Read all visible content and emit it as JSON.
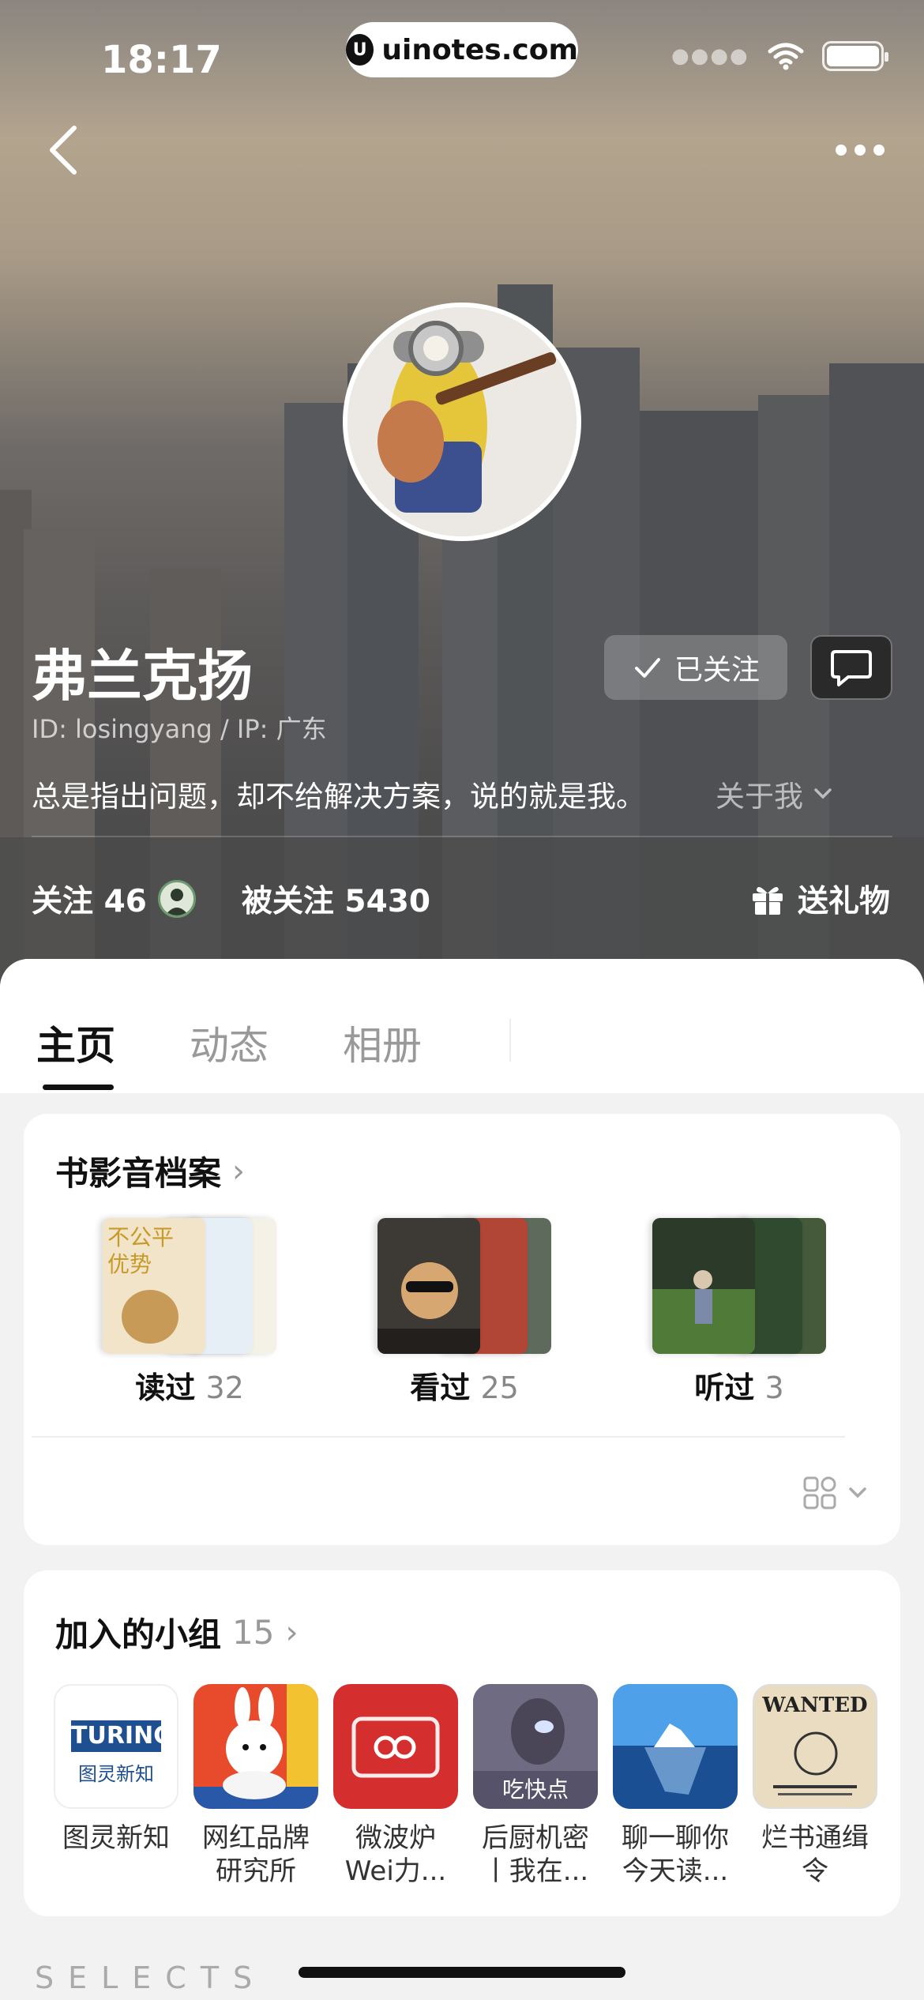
{
  "status_bar": {
    "time": "18:17",
    "url": "uinotes.com",
    "url_logo": "U"
  },
  "profile": {
    "name": "弗兰克扬",
    "id_line": "ID: losingyang / IP: 广东",
    "followed_label": "已关注",
    "bio": "总是指出问题，却不给解决方案，说的就是我。",
    "about_label": "关于我",
    "following_label": "关注 46",
    "followers_label": "被关注 5430",
    "gift_label": "送礼物"
  },
  "tabs": [
    {
      "label": "主页",
      "active": true
    },
    {
      "label": "动态",
      "active": false
    },
    {
      "label": "相册",
      "active": false
    }
  ],
  "archive": {
    "title": "书影音档案",
    "items": [
      {
        "label": "读过",
        "count": "32"
      },
      {
        "label": "看过",
        "count": "25"
      },
      {
        "label": "听过",
        "count": "3"
      }
    ]
  },
  "groups": {
    "title": "加入的小组",
    "count": "15",
    "items": [
      {
        "name": "图灵新知",
        "icon_text": "TURING",
        "icon_sub": "图灵新知"
      },
      {
        "name": "网红品牌\n研究所"
      },
      {
        "name": "微波炉\nWei力..."
      },
      {
        "name": "后厨机密\n丨我在...",
        "icon_text": "吃快点"
      },
      {
        "name": "聊一聊你\n今天读..."
      },
      {
        "name": "烂书通缉\n令",
        "icon_text": "WANTED"
      }
    ]
  },
  "footer": {
    "section_label": "SELECTS"
  },
  "colors": {
    "accent_red": "#d9322e",
    "text_primary": "#111111",
    "text_muted": "#999999"
  }
}
